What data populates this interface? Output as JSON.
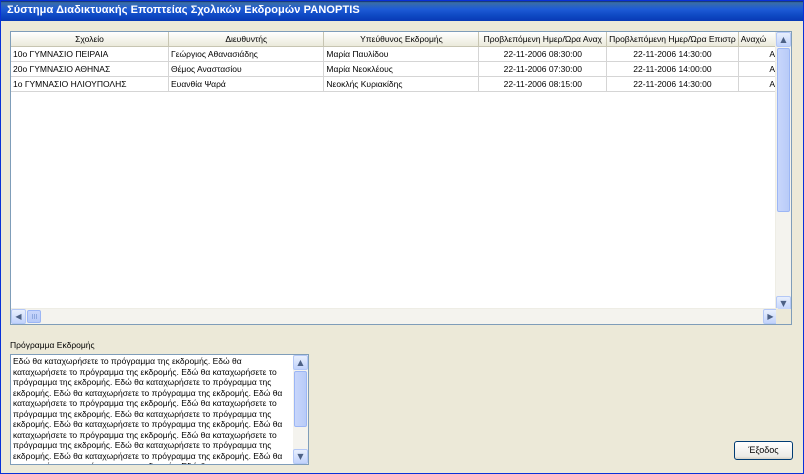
{
  "window": {
    "title": "Σύστημα Διαδικτυακής Εποπτείας Σχολικών Εκδρομών PANOPTIS"
  },
  "table": {
    "columns": [
      "Σχολείο",
      "Διευθυντής",
      "Υπεύθυνος Εκδρομής",
      "Προβλεπόμενη Ημερ/Ώρα Αναχ",
      "Προβλεπόμενη Ημερ/Ώρα Επιστρ",
      "Αναχώ"
    ],
    "rows": [
      [
        "10ο ΓΥΜΝΑΣΙΟ ΠΕΙΡΑΙΑ",
        "Γεώργιος Αθανασιάδης",
        "Μαρία Παυλίδου",
        "22-11-2006 08:30:00",
        "22-11-2006 14:30:00",
        "Α"
      ],
      [
        "20ο ΓΥΜΝΑΣΙΟ ΑΘΗΝΑΣ",
        "Θέμος Αναστασίου",
        "Μαρία Νεοκλέους",
        "22-11-2006 07:30:00",
        "22-11-2006 14:00:00",
        "Α"
      ],
      [
        "1ο ΓΥΜΝΑΣΙΟ ΗΛΙΟΥΠΟΛΗΣ",
        "Ευανθία Ψαρά",
        "Νεοκλής Κυριακίδης",
        "22-11-2006 08:15:00",
        "22-11-2006 14:30:00",
        "Α"
      ]
    ]
  },
  "program": {
    "label": "Πρόγραμμα Εκδρομής",
    "text": "Εδώ θα καταχωρήσετε το πρόγραμμα της εκδρομής. Εδώ θα καταχωρήσετε το πρόγραμμα της εκδρομής. Εδώ θα καταχωρήσετε το πρόγραμμα της εκδρομής. Εδώ θα καταχωρήσετε το πρόγραμμα της εκδρομής. Εδώ θα καταχωρήσετε το πρόγραμμα της εκδρομής. Εδώ θα καταχωρήσετε το πρόγραμμα της εκδρομής. Εδώ θα καταχωρήσετε το πρόγραμμα της εκδρομής. Εδώ θα καταχωρήσετε το πρόγραμμα της εκδρομής. Εδώ θα καταχωρήσετε το πρόγραμμα της εκδρομής. Εδώ θα καταχωρήσετε το πρόγραμμα της εκδρομής. Εδώ θα καταχωρήσετε το πρόγραμμα της εκδρομής. Εδώ θα καταχωρήσετε το πρόγραμμα της εκδρομής. Εδώ θα καταχωρήσετε το πρόγραμμα της εκδρομής. Εδώ θα καταχωρήσετε το πρόγραμμα της εκδρομής. Εδώ θα"
  },
  "buttons": {
    "exit_label": "Έξοδος"
  },
  "icons": {
    "scroll_up": "▲",
    "scroll_down": "▼",
    "scroll_left": "◀",
    "scroll_right": "▶"
  }
}
